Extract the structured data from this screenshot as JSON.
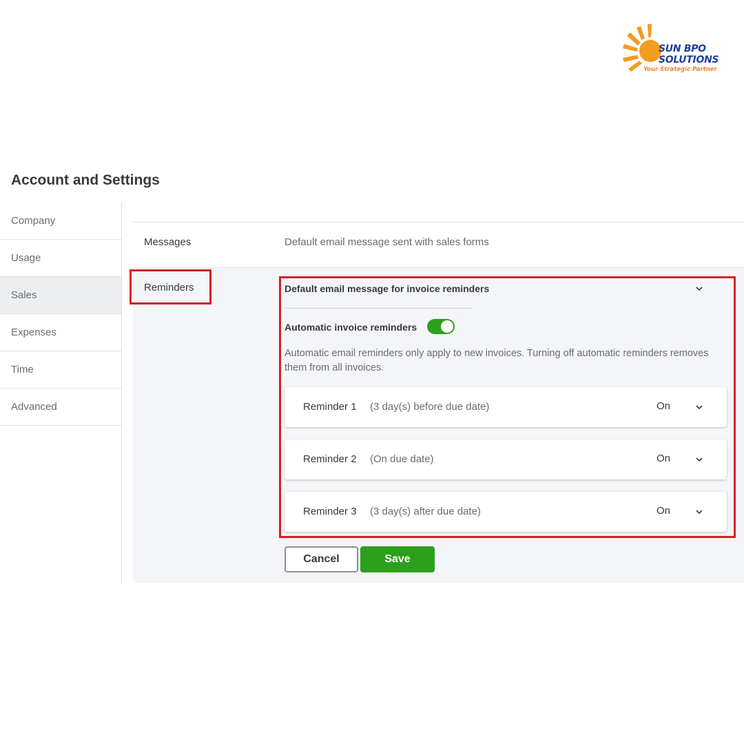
{
  "logo": {
    "line1": "SUN BPO",
    "line2": "SOLUTIONS",
    "tagline": "Your Strategic Partner",
    "colors": {
      "brand": "#1f3f9a",
      "sun": "#f39c1f"
    }
  },
  "page": {
    "title": "Account and Settings"
  },
  "sidebar": {
    "items": [
      {
        "label": "Company"
      },
      {
        "label": "Usage"
      },
      {
        "label": "Sales"
      },
      {
        "label": "Expenses"
      },
      {
        "label": "Time"
      },
      {
        "label": "Advanced"
      }
    ],
    "active": "Sales"
  },
  "messages": {
    "label": "Messages",
    "description": "Default email message sent with sales forms"
  },
  "reminders": {
    "label": "Reminders",
    "default_email_label": "Default email message for invoice reminders",
    "auto_label": "Automatic invoice reminders",
    "auto_enabled": true,
    "auto_description": "Automatic email reminders only apply to new invoices. Turning off automatic reminders removes them from all invoices.",
    "items": [
      {
        "name": "Reminder 1",
        "when": "(3 day(s) before due date)",
        "status": "On"
      },
      {
        "name": "Reminder 2",
        "when": "(On due date)",
        "status": "On"
      },
      {
        "name": "Reminder 3",
        "when": "(3 day(s) after due date)",
        "status": "On"
      }
    ]
  },
  "actions": {
    "cancel": "Cancel",
    "save": "Save"
  },
  "colors": {
    "accent_green": "#2ca01c",
    "highlight_red": "#d42027"
  }
}
